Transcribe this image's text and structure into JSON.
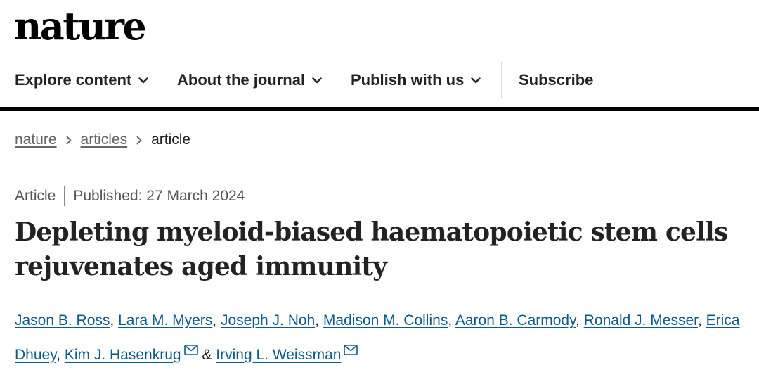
{
  "header": {
    "logo": "nature"
  },
  "nav": {
    "items": [
      {
        "label": "Explore content",
        "icon": "chevron-down-icon"
      },
      {
        "label": "About the journal",
        "icon": "chevron-down-icon"
      },
      {
        "label": "Publish with us",
        "icon": "chevron-down-icon"
      },
      {
        "label": "Subscribe"
      }
    ]
  },
  "breadcrumb": {
    "items": [
      "nature",
      "articles",
      "article"
    ],
    "separator_icon": "chevron-right-icon"
  },
  "article": {
    "type": "Article",
    "published": "Published: 27 March 2024",
    "title": "Depleting myeloid-biased haematopoietic stem cells rejuvenates aged immunity",
    "authors": [
      "Jason B. Ross",
      "Lara M. Myers",
      "Joseph J. Noh",
      "Madison M. Collins",
      "Aaron B. Carmody",
      "Ronald J. Messer",
      "Erica Dhuey",
      "Kim J. Hasenkrug",
      "Irving L. Weissman"
    ],
    "author_separator": ",",
    "conjunction": "&",
    "mail_icon": "mail-icon"
  },
  "colors": {
    "link": "#0c5a8a",
    "breadcrumb_link": "#666666",
    "text": "#222222",
    "nav_bar": "#000000"
  }
}
